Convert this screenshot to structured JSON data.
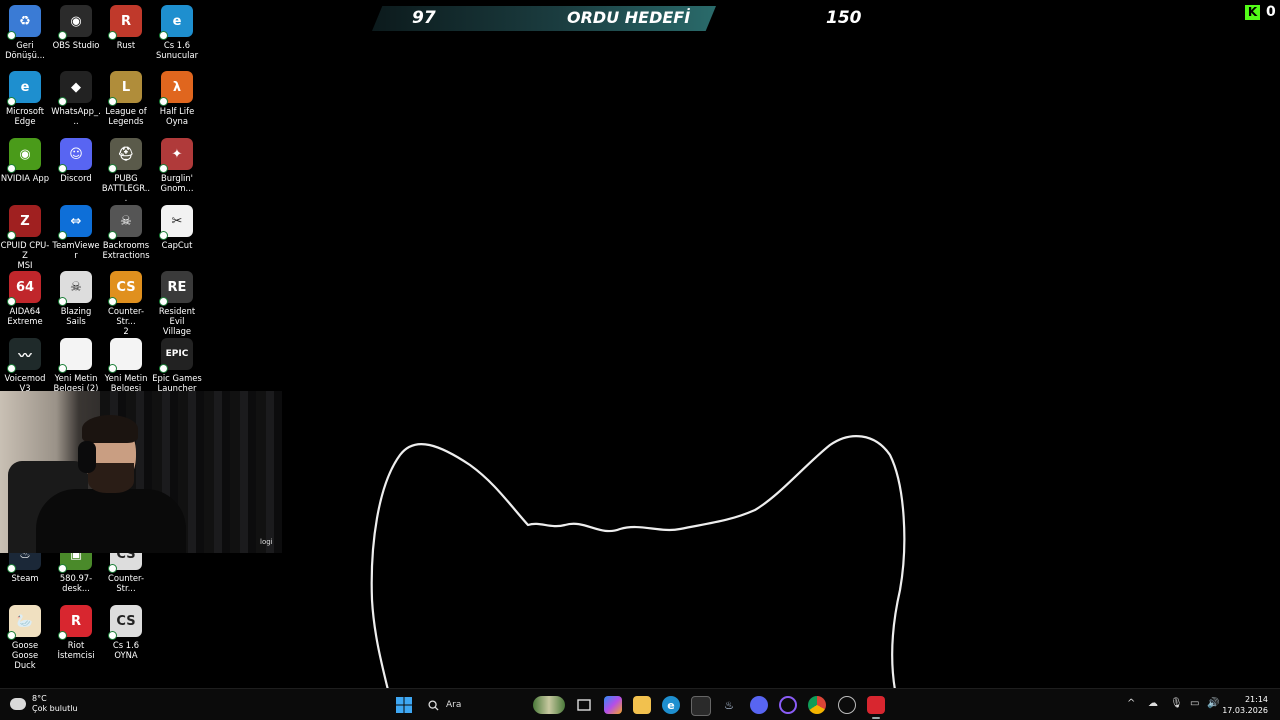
{
  "overlay": {
    "left_value": "97",
    "title": "ORDU HEDEFİ",
    "right_value": "150",
    "kick_count": "0",
    "kick_logo": "K"
  },
  "desktop_icons": [
    {
      "label": "Geri\nDönüşü...",
      "icon": "recycle-bin-icon",
      "color": "#3a7bd5",
      "glyph": "♻"
    },
    {
      "label": "OBS Studio",
      "icon": "obs-icon",
      "color": "#2b2b2b",
      "glyph": "◉"
    },
    {
      "label": "Rust",
      "icon": "rust-icon",
      "color": "#c0392b",
      "glyph": "R"
    },
    {
      "label": "Cs 1.6\nSunucular",
      "icon": "edge-icon",
      "color": "#1e8fcf",
      "glyph": "e"
    },
    {
      "label": "Microsoft\nEdge",
      "icon": "edge-icon",
      "color": "#1e8fcf",
      "glyph": "e"
    },
    {
      "label": "WhatsApp_...",
      "icon": "whatsapp-icon",
      "color": "#222",
      "glyph": "◆"
    },
    {
      "label": "League of\nLegends",
      "icon": "league-icon",
      "color": "#b08d3a",
      "glyph": "L"
    },
    {
      "label": "Half Life\nOyna",
      "icon": "half-life-icon",
      "color": "#e0661e",
      "glyph": "λ"
    },
    {
      "label": "NVIDIA App",
      "icon": "nvidia-icon",
      "color": "#4a9b1a",
      "glyph": "◉"
    },
    {
      "label": "Discord",
      "icon": "discord-icon",
      "color": "#5865f2",
      "glyph": "☺"
    },
    {
      "label": "PUBG\nBATTLEGR...",
      "icon": "pubg-icon",
      "color": "#5a5a4a",
      "glyph": "⛑"
    },
    {
      "label": "Burglin'\nGnom...",
      "icon": "burglin-gnomes-icon",
      "color": "#b03a3a",
      "glyph": "✦"
    },
    {
      "label": "CPUID CPU-Z\nMSI",
      "icon": "cpuz-icon",
      "color": "#a02020",
      "glyph": "Z"
    },
    {
      "label": "TeamViewer",
      "icon": "teamviewer-icon",
      "color": "#0e6fd8",
      "glyph": "⇔"
    },
    {
      "label": "Backrooms\nExtractions",
      "icon": "backrooms-icon",
      "color": "#555",
      "glyph": "☠"
    },
    {
      "label": "CapCut",
      "icon": "capcut-icon",
      "color": "#f2f2f2",
      "glyph": "✂"
    },
    {
      "label": "AIDA64\nExtreme",
      "icon": "aida64-icon",
      "color": "#c0262b",
      "glyph": "64"
    },
    {
      "label": "Blazing Sails",
      "icon": "blazing-sails-icon",
      "color": "#ddd",
      "glyph": "☠"
    },
    {
      "label": "Counter-Str...\n2",
      "icon": "counter-strike-2-icon",
      "color": "#e0901e",
      "glyph": "CS"
    },
    {
      "label": "Resident Evil\nVillage",
      "icon": "resident-evil-icon",
      "color": "#3a3a3a",
      "glyph": "RE"
    },
    {
      "label": "Voicemod V3",
      "icon": "voicemod-icon",
      "color": "#1f2a2a",
      "glyph": "〰"
    },
    {
      "label": "Yeni Metin\nBelgesi (2)",
      "icon": "text-document-icon",
      "color": "#f4f4f4",
      "glyph": ""
    },
    {
      "label": "Yeni Metin\nBelgesi",
      "icon": "text-document-icon",
      "color": "#f4f4f4",
      "glyph": ""
    },
    {
      "label": "Epic Games\nLauncher",
      "icon": "epic-games-icon",
      "color": "#222",
      "glyph": "EPIC"
    },
    {
      "label": "Steam",
      "icon": "steam-icon",
      "color": "#1b2838",
      "glyph": "♨"
    },
    {
      "label": "580.97-desk...",
      "icon": "driver-installer-icon",
      "color": "#4a8a2a",
      "glyph": "▣"
    },
    {
      "label": "Counter-Str...",
      "icon": "counter-strike-icon",
      "color": "#ddd",
      "glyph": "CS"
    },
    {
      "label": "Goose Goose\nDuck",
      "icon": "goose-goose-duck-icon",
      "color": "#f0e0c0",
      "glyph": "🦢"
    },
    {
      "label": "Riot İstemcisi",
      "icon": "riot-client-icon",
      "color": "#d8262f",
      "glyph": "R"
    },
    {
      "label": "Cs 1.6 OYNA",
      "icon": "counter-strike-icon",
      "color": "#ddd",
      "glyph": "CS"
    }
  ],
  "webcam": {
    "brand": "logi"
  },
  "taskbar": {
    "weather_temp": "8°C",
    "weather_desc": "Çok bulutlu",
    "search_placeholder": "Ara",
    "time": "21:14",
    "date": "17.03.2026"
  }
}
